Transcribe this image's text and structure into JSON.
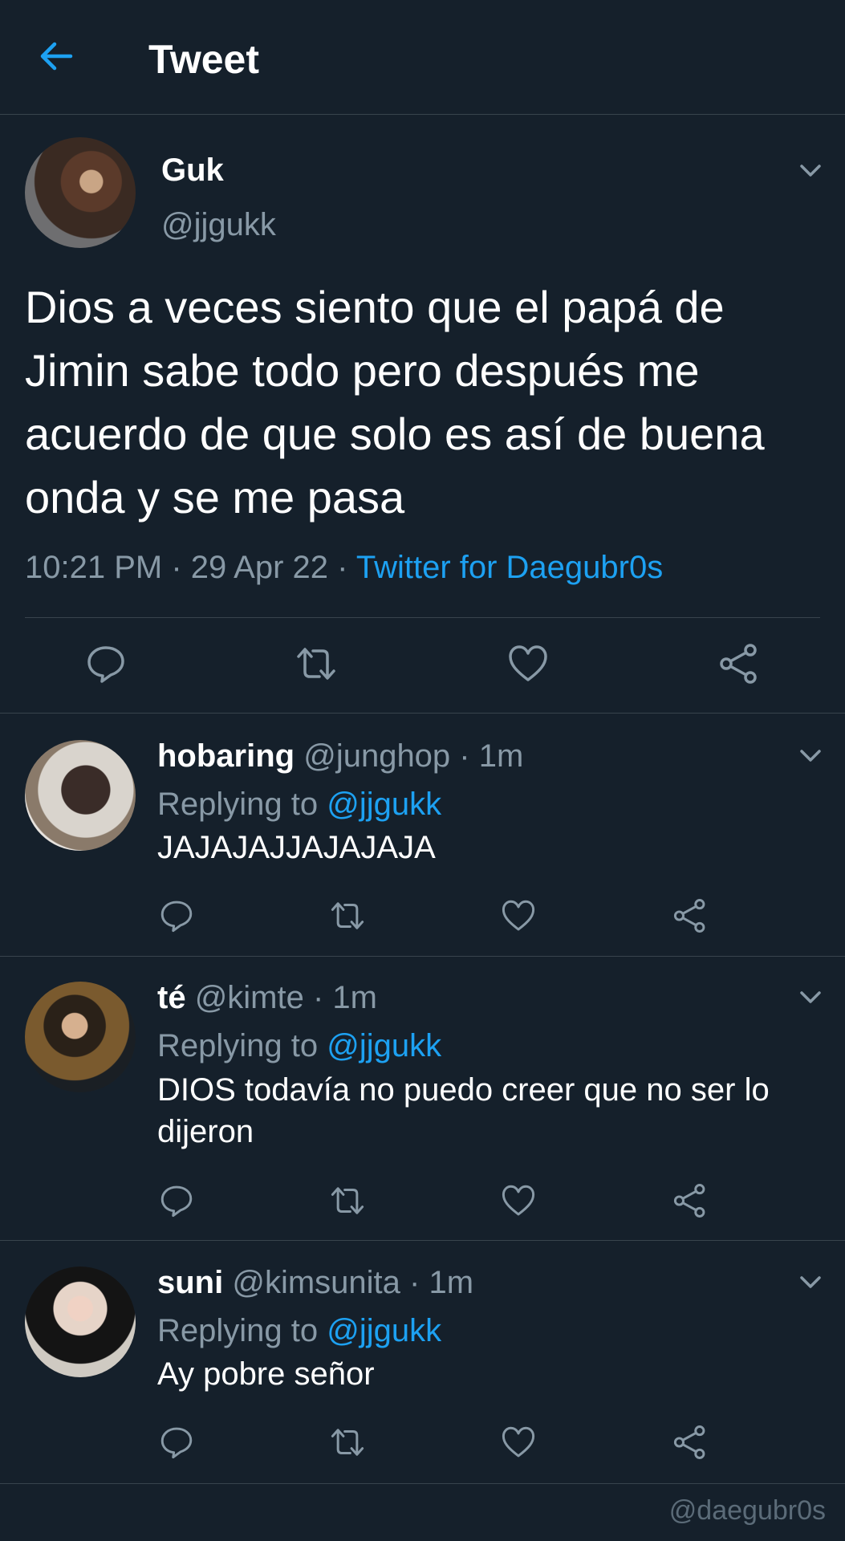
{
  "header": {
    "title": "Tweet",
    "back_icon": "arrow-left-icon"
  },
  "colors": {
    "background": "#15202b",
    "accent": "#1da1f2",
    "muted": "#8899a6",
    "border": "#38444d"
  },
  "main_tweet": {
    "name": "Guk",
    "handle": "@jjgukk",
    "text": "Dios a veces siento que el papá de Jimin sabe todo pero después me acuerdo de que solo es así de buena onda y se me pasa",
    "time": "10:21 PM · 29 Apr 22 · ",
    "source": "Twitter for Daegubr0s",
    "actions": [
      "reply-icon",
      "retweet-icon",
      "like-icon",
      "share-icon"
    ]
  },
  "replies": [
    {
      "name": "hobaring",
      "meta": " @junghop · 1m",
      "replying_to_label": "Replying to ",
      "replying_to": "@jjgukk",
      "text": "JAJAJAJJAJAJAJA"
    },
    {
      "name": "té",
      "meta": " @kimte · 1m",
      "replying_to_label": "Replying to ",
      "replying_to": "@jjgukk",
      "text": "DIOS todavía no puedo creer que no ser lo dijeron"
    },
    {
      "name": "suni",
      "meta": " @kimsunita · 1m",
      "replying_to_label": "Replying to ",
      "replying_to": "@jjgukk",
      "text": "Ay pobre señor"
    }
  ],
  "watermark": "@daegubr0s"
}
